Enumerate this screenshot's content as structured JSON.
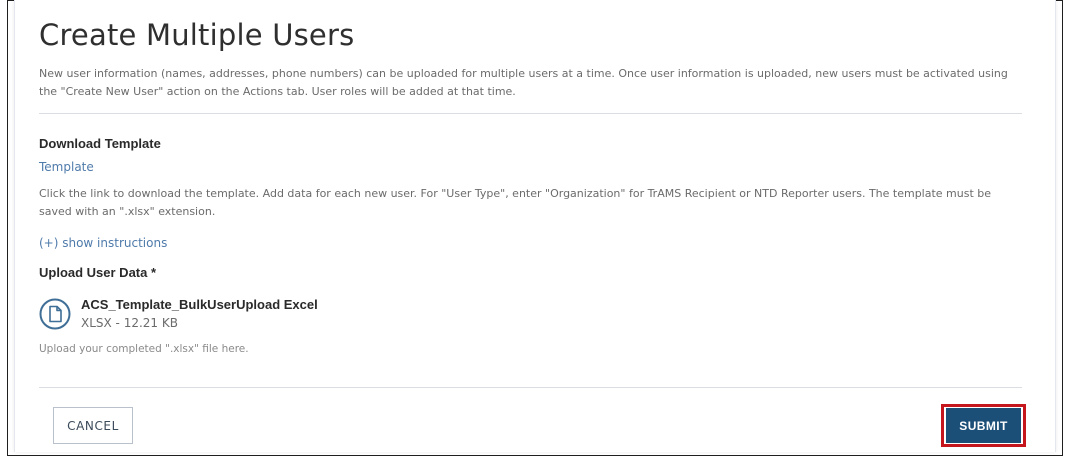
{
  "page": {
    "title": "Create Multiple Users",
    "intro": "New user information (names, addresses, phone numbers) can be uploaded for multiple users at a time. Once user information is uploaded, new users must be activated using the \"Create New User\" action on the Actions tab. User roles will be added at that time."
  },
  "download_template": {
    "heading": "Download Template",
    "link_label": "Template",
    "help": "Click the link to download the template. Add data for each new user. For \"User Type\", enter \"Organization\" for TrAMS Recipient or NTD Reporter users. The template must be saved with an \".xlsx\" extension.",
    "instructions_toggle": "(+) show instructions"
  },
  "upload": {
    "heading": "Upload User Data *",
    "file_name": "ACS_Template_BulkUserUpload Excel",
    "file_meta": "XLSX  -  12.21 KB",
    "hint": "Upload your completed \".xlsx\" file here.",
    "icon": "file-icon"
  },
  "actions": {
    "cancel_label": "CANCEL",
    "submit_label": "SUBMIT"
  },
  "colors": {
    "submit_bg": "#1c4f78",
    "highlight": "#c4161c",
    "link": "#4f7bab"
  }
}
